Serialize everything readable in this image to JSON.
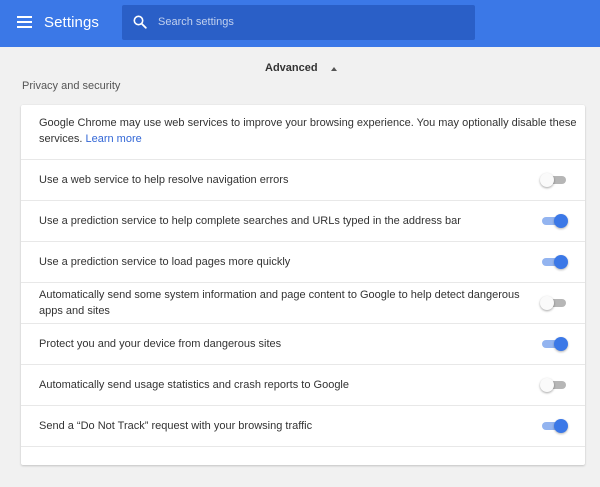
{
  "header": {
    "title": "Settings",
    "search_placeholder": "Search settings"
  },
  "advanced_label": "Advanced",
  "section_title": "Privacy and security",
  "intro": {
    "text": "Google Chrome may use web services to improve your browsing experience. You may optionally disable these services. ",
    "link": "Learn more"
  },
  "rows": [
    {
      "label": "Use a web service to help resolve navigation errors",
      "enabled": false
    },
    {
      "label": "Use a prediction service to help complete searches and URLs typed in the address bar",
      "enabled": true
    },
    {
      "label": "Use a prediction service to load pages more quickly",
      "enabled": true
    },
    {
      "label": "Automatically send some system information and page content to Google to help detect dangerous apps and sites",
      "enabled": false
    },
    {
      "label": "Protect you and your device from dangerous sites",
      "enabled": true
    },
    {
      "label": "Automatically send usage statistics and crash reports to Google",
      "enabled": false
    },
    {
      "label": "Send a “Do Not Track” request with your browsing traffic",
      "enabled": true
    }
  ],
  "colors": {
    "header_bg": "#3b78e7",
    "toggle_on": "#3b78e7",
    "link": "#3367d6"
  }
}
